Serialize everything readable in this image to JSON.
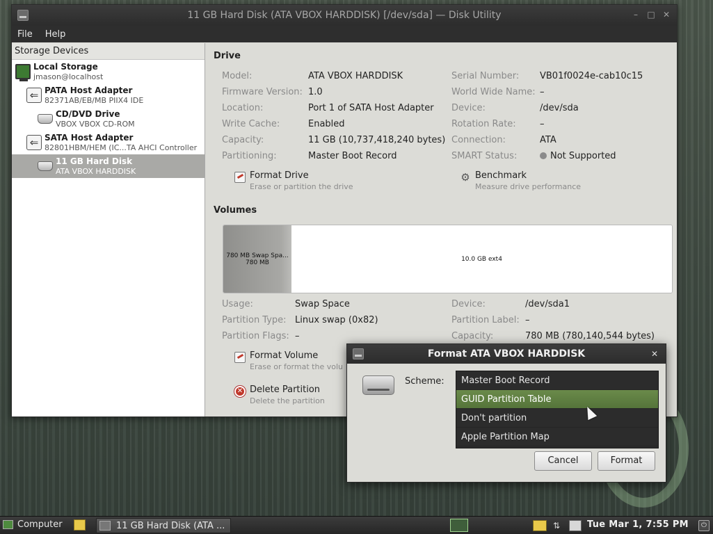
{
  "window": {
    "title": "11 GB Hard Disk (ATA VBOX HARDDISK) [/dev/sda] — Disk Utility",
    "menu": [
      "File",
      "Help"
    ]
  },
  "sidebar": {
    "header": "Storage Devices",
    "items": [
      {
        "title": "Local Storage",
        "subtitle": "jmason@localhost",
        "icon": "computer-icon"
      },
      {
        "title": "PATA Host Adapter",
        "subtitle": "82371AB/EB/MB PIIX4 IDE",
        "icon": "adapter-icon"
      },
      {
        "title": "CD/DVD Drive",
        "subtitle": "VBOX VBOX CD-ROM",
        "icon": "optical-drive-icon"
      },
      {
        "title": "SATA Host Adapter",
        "subtitle": "82801HBM/HEM (IC...TA AHCI Controller",
        "icon": "adapter-icon"
      },
      {
        "title": "11 GB Hard Disk",
        "subtitle": "ATA VBOX HARDDISK",
        "icon": "hard-disk-icon",
        "selected": true
      }
    ]
  },
  "drive": {
    "section_title": "Drive",
    "left": [
      {
        "label": "Model:",
        "value": "ATA VBOX HARDDISK"
      },
      {
        "label": "Firmware Version:",
        "value": "1.0"
      },
      {
        "label": "Location:",
        "value": "Port 1 of SATA Host Adapter"
      },
      {
        "label": "Write Cache:",
        "value": "Enabled"
      },
      {
        "label": "Capacity:",
        "value": "11 GB (10,737,418,240 bytes)"
      },
      {
        "label": "Partitioning:",
        "value": "Master Boot Record"
      }
    ],
    "right": [
      {
        "label": "Serial Number:",
        "value": "VB01f0024e-cab10c15"
      },
      {
        "label": "World Wide Name:",
        "value": "–"
      },
      {
        "label": "Device:",
        "value": "/dev/sda"
      },
      {
        "label": "Rotation Rate:",
        "value": "–"
      },
      {
        "label": "Connection:",
        "value": "ATA"
      },
      {
        "label": "SMART Status:",
        "value": "Not Supported"
      }
    ],
    "actions": [
      {
        "title": "Format Drive",
        "subtitle": "Erase or partition the drive"
      },
      {
        "title": "Benchmark",
        "subtitle": "Measure drive performance"
      }
    ]
  },
  "volumes": {
    "section_title": "Volumes",
    "segments": [
      {
        "label": "780 MB Swap Spa...",
        "size": "780 MB"
      },
      {
        "label": "10.0 GB ext4"
      }
    ],
    "left": [
      {
        "label": "Usage:",
        "value": "Swap Space"
      },
      {
        "label": "Partition Type:",
        "value": "Linux swap (0x82)"
      },
      {
        "label": "Partition Flags:",
        "value": "–"
      }
    ],
    "right": [
      {
        "label": "Device:",
        "value": "/dev/sda1"
      },
      {
        "label": "Partition Label:",
        "value": "–"
      },
      {
        "label": "Capacity:",
        "value": "780 MB (780,140,544 bytes)"
      }
    ],
    "actions": [
      {
        "title": "Format Volume",
        "subtitle": "Erase or format the volu"
      },
      {
        "title": "Delete Partition",
        "subtitle": "Delete the partition"
      }
    ]
  },
  "dialog": {
    "title": "Format ATA VBOX HARDDISK",
    "scheme_label": "Scheme:",
    "options": [
      "Master Boot Record",
      "GUID Partition Table",
      "Don't partition",
      "Apple Partition Map"
    ],
    "highlighted_option": "GUID Partition Table",
    "cancel_label": "Cancel",
    "format_label": "Format"
  },
  "taskbar": {
    "start_label": "Computer",
    "task_label": "11 GB Hard Disk (ATA ...",
    "clock": "Tue Mar  1,  7:55 PM"
  },
  "colors": {
    "highlight": "#5f7f42",
    "titlebar": "#2e2e2e",
    "window_bg": "#dcdcd7",
    "selected_row": "#a9a9a6"
  }
}
